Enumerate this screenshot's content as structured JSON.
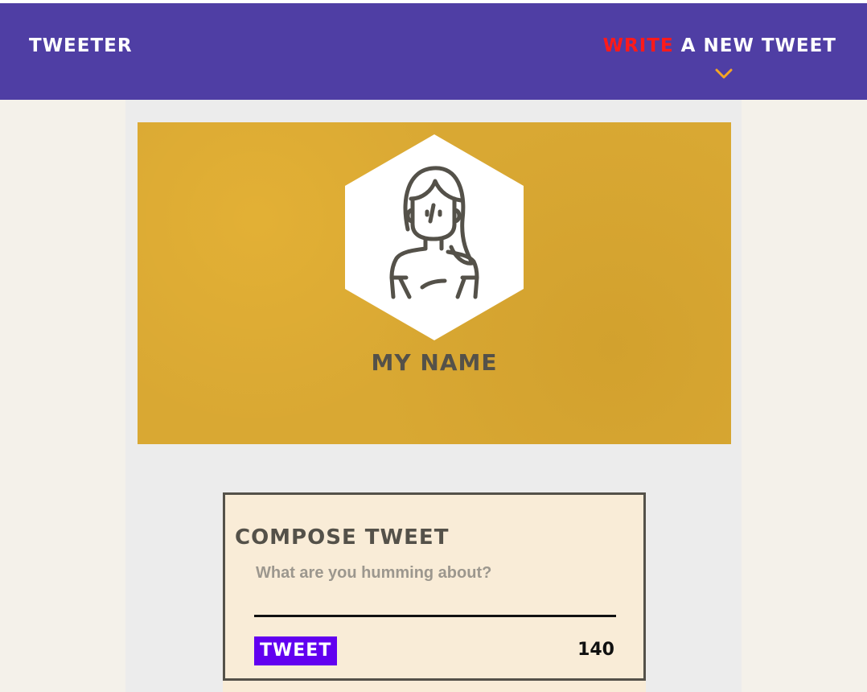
{
  "nav": {
    "brand": "Tweeter",
    "compose_accent": "Write",
    "compose_rest": " a new tweet",
    "chevron_icon": "chevron-down-icon"
  },
  "profile": {
    "name": "My Name",
    "avatar_icon": "woman-avatar-icon"
  },
  "compose": {
    "title": "Compose Tweet",
    "placeholder": "What are you humming about?",
    "value": "",
    "button_label": "Tweet",
    "counter": "140"
  },
  "colors": {
    "nav_bg": "#4f3ea4",
    "accent_red": "#ff1a1a",
    "chevron": "#f5a623",
    "profile_bg": "#d9a833",
    "compose_bg": "#f9ecd7",
    "tweet_button": "#6200f0",
    "text_dark": "#545149"
  }
}
